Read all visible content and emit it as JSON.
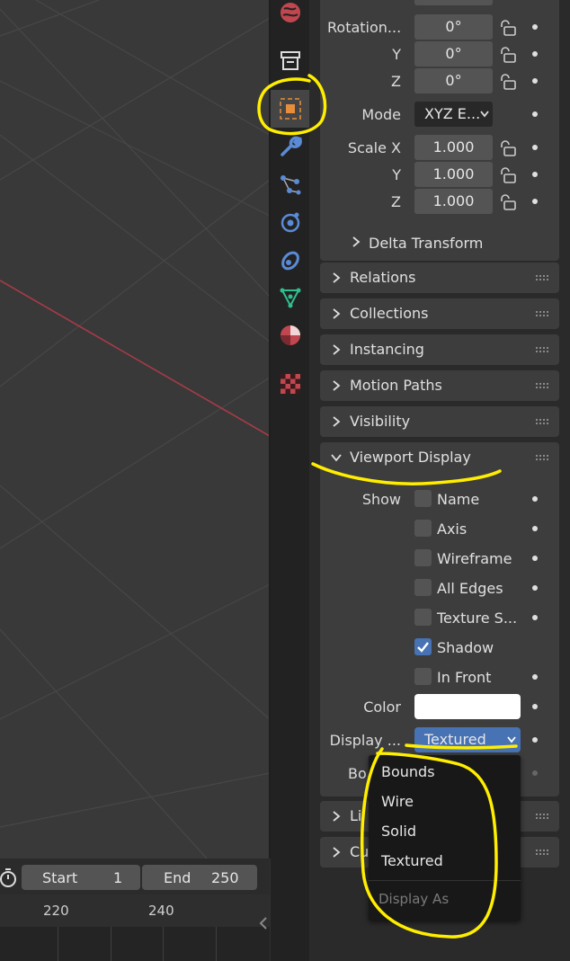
{
  "object_transform": {
    "rotation": {
      "label_x": "Rotation...",
      "label_y": "Y",
      "label_z": "Z",
      "x": "0°",
      "y": "0°",
      "z": "0°"
    },
    "mode": {
      "label": "Mode",
      "value": "XYZ E..."
    },
    "scale": {
      "label_x": "Scale X",
      "label_y": "Y",
      "label_z": "Z",
      "x": "1.000",
      "y": "1.000",
      "z": "1.000"
    },
    "delta_transform": "Delta Transform"
  },
  "panels": {
    "relations": "Relations",
    "collections": "Collections",
    "instancing": "Instancing",
    "motion_paths": "Motion Paths",
    "visibility": "Visibility",
    "viewport_display": "Viewport Display",
    "lineart_partial": "Li",
    "custom_partial": "Cu"
  },
  "viewport_display": {
    "show_label": "Show",
    "checkboxes": [
      {
        "label": "Name",
        "checked": false
      },
      {
        "label": "Axis",
        "checked": false
      },
      {
        "label": "Wireframe",
        "checked": false
      },
      {
        "label": "All Edges",
        "checked": false
      },
      {
        "label": "Texture S...",
        "checked": false
      },
      {
        "label": "Shadow",
        "checked": true
      },
      {
        "label": "In Front",
        "checked": false
      }
    ],
    "color_label": "Color",
    "color_value": "#ffffff",
    "display_label": "Display ...",
    "display_value": "Textured",
    "bounds_label_partial": "Bo"
  },
  "dropdown": {
    "items": [
      "Bounds",
      "Wire",
      "Solid",
      "Textured"
    ],
    "caption": "Display As"
  },
  "timeline": {
    "start_label": "Start",
    "start_value": "1",
    "end_label": "End",
    "end_value": "250",
    "ruler": [
      "220",
      "240"
    ]
  },
  "colors": {
    "accent": "#4772b3",
    "annotation": "#ffee00",
    "object_tab": "#e88d3a"
  }
}
